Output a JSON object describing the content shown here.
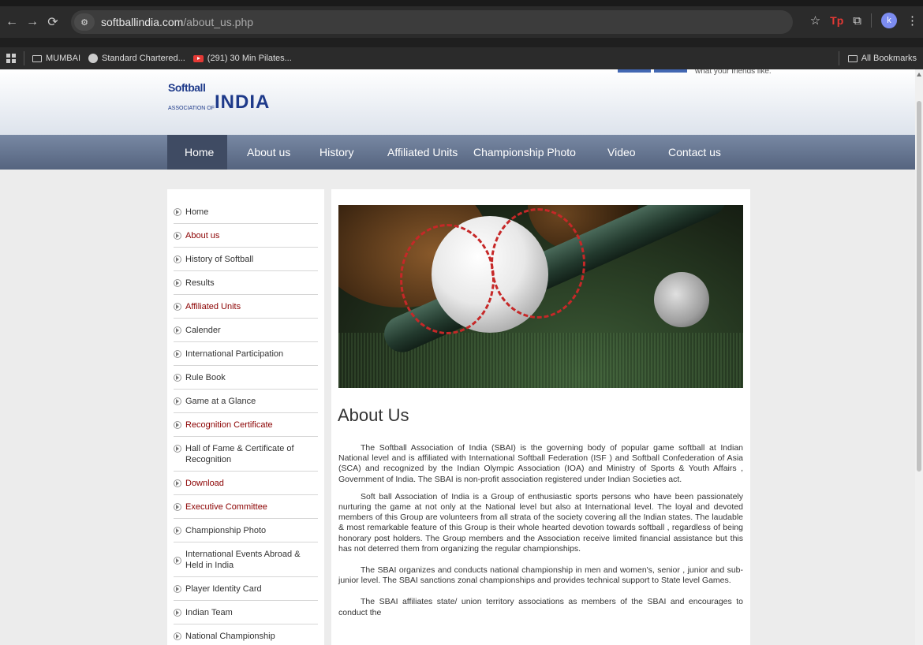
{
  "browser": {
    "url_domain": "softballindia.com",
    "url_path": "/about_us.php",
    "avatar_letter": "k",
    "extension_label": "Tp",
    "bookmarks": [
      {
        "label": "MUMBAI",
        "icon": "folder-icon"
      },
      {
        "label": "Standard Chartered...",
        "icon": "globe-icon"
      },
      {
        "label": "(291) 30 Min Pilates...",
        "icon": "youtube-icon"
      }
    ],
    "all_bookmarks": "All Bookmarks"
  },
  "header": {
    "logo_top": "Softball",
    "logo_assoc": "ASSOCIATION OF",
    "logo_india": "INDIA",
    "fb_text": "what your friends like."
  },
  "nav": [
    "Home",
    "About us",
    "History",
    "Affiliated Units",
    "Championship Photo",
    "Video",
    "Contact us"
  ],
  "sidebar": [
    {
      "label": "Home",
      "red": false
    },
    {
      "label": "About us",
      "red": true
    },
    {
      "label": "History of Softball",
      "red": false
    },
    {
      "label": "Results",
      "red": false
    },
    {
      "label": "Affiliated Units",
      "red": true
    },
    {
      "label": "Calender",
      "red": false
    },
    {
      "label": "International Participation",
      "red": false
    },
    {
      "label": "Rule Book",
      "red": false
    },
    {
      "label": "Game at a Glance",
      "red": false
    },
    {
      "label": "Recognition Certificate",
      "red": true
    },
    {
      "label": "Hall of Fame & Certificate of Recognition",
      "red": false
    },
    {
      "label": "Download",
      "red": true
    },
    {
      "label": "Executive Committee",
      "red": true
    },
    {
      "label": "Championship Photo",
      "red": false
    },
    {
      "label": "International Events Abroad & Held in India",
      "red": false
    },
    {
      "label": "Player Identity Card",
      "red": false
    },
    {
      "label": "Indian Team",
      "red": false
    },
    {
      "label": "National Championship",
      "red": false
    }
  ],
  "main": {
    "title": "About Us",
    "paragraphs": [
      "The Softball Association of India (SBAI) is the governing body of popular game softball at Indian National level and is affiliated with International Softball Federation (ISF ) and Softball Confederation of Asia (SCA) and recognized by the Indian Olympic Association (IOA) and Ministry of Sports & Youth Affairs , Government of India. The SBAI is non-profit association registered under Indian Societies act.",
      "Soft ball Association of India is a Group of enthusiastic sports persons who have been passionately nurturing the game at not only at the National level but also at International level. The loyal and devoted members of this Group are volunteers from all strata of the society covering all the Indian states. The laudable & most remarkable feature of this Group is their whole hearted devotion towards softball , regardless of being honorary post holders. The Group members and the Association receive limited financial assistance but this has not deterred them from organizing the regular championships.",
      "The SBAI organizes and conducts national championship in men and women's, senior , junior and sub-junior level. The SBAI sanctions zonal championships and provides technical support to State level Games.",
      "The SBAI affiliates state/ union territory associations as members of the SBAI and encourages to conduct the"
    ]
  }
}
